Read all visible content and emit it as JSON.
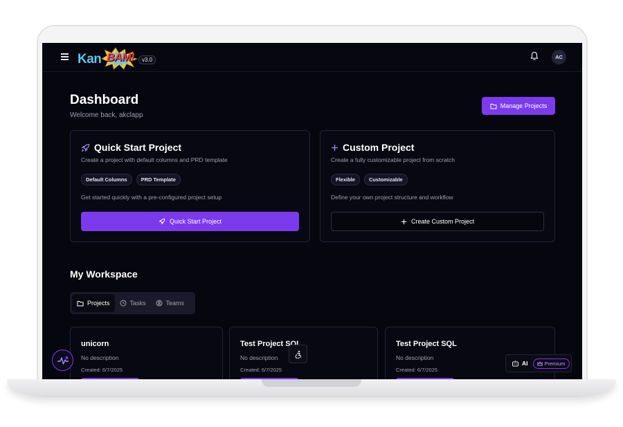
{
  "app": {
    "logo_kan": "Kan",
    "logo_bam": "BAM!",
    "version": "v3.0",
    "user_initials": "AC"
  },
  "header": {
    "title": "Dashboard",
    "welcome": "Welcome back, akclapp",
    "manage_label": "Manage Projects"
  },
  "quick_start": {
    "title": "Quick Start Project",
    "description": "Create a project with default columns and PRD template",
    "tags": [
      "Default Columns",
      "PRD Template"
    ],
    "note": "Get started quickly with a pre-configured project setup",
    "button_label": "Quick Start Project"
  },
  "custom_project": {
    "title": "Custom Project",
    "description": "Create a fully customizable project from scratch",
    "tags": [
      "Flexible",
      "Customizable"
    ],
    "note": "Define your own project structure and workflow",
    "button_label": "Create Custom Project"
  },
  "workspace": {
    "title": "My Workspace",
    "tabs": [
      {
        "label": "Projects",
        "active": true
      },
      {
        "label": "Tasks",
        "active": false
      },
      {
        "label": "Teams",
        "active": false
      }
    ],
    "projects": [
      {
        "name": "unicorn",
        "description": "No description",
        "created": "Created: 6/7/2025"
      },
      {
        "name": "Test Project SQL",
        "description": "No description",
        "created": "Created: 6/7/2025"
      },
      {
        "name": "Test Project SQL",
        "description": "No description",
        "created": "Created: 6/7/2025"
      }
    ]
  },
  "ai_widget": {
    "label": "AI",
    "premium": "Premium"
  },
  "colors": {
    "accent": "#7c3aed",
    "background": "#06060f",
    "logo_blue": "#5ec6f2",
    "logo_red": "#ff3a3a"
  }
}
